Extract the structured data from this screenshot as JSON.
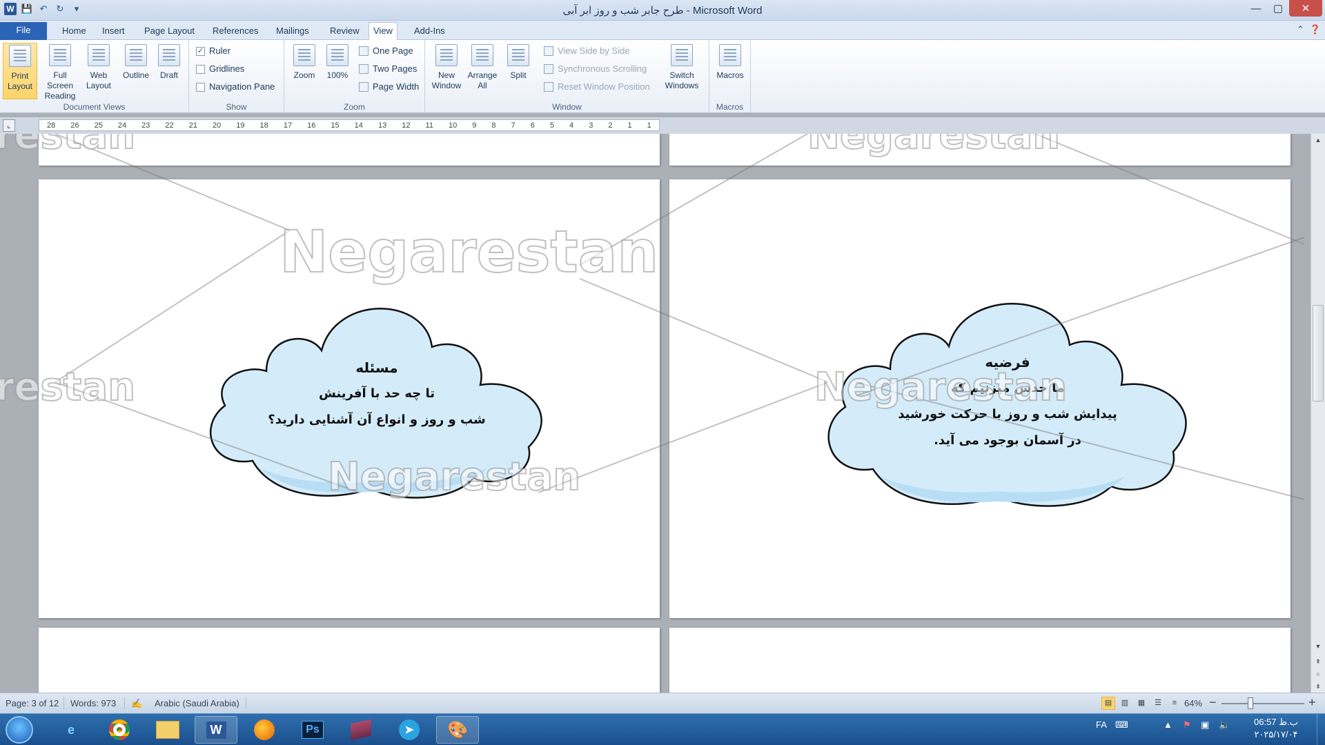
{
  "window": {
    "title": "طرح جابر شب و روز ابر آبی - Microsoft Word",
    "min": "—",
    "max": "▢",
    "close": "✕"
  },
  "qat": {
    "word": "W",
    "save": "💾",
    "undo": "↶",
    "redo": "↻",
    "custom": "▾"
  },
  "tabs": [
    {
      "label": "File"
    },
    {
      "label": "Home"
    },
    {
      "label": "Insert"
    },
    {
      "label": "Page Layout"
    },
    {
      "label": "References"
    },
    {
      "label": "Mailings"
    },
    {
      "label": "Review"
    },
    {
      "label": "View"
    },
    {
      "label": "Add-Ins"
    }
  ],
  "ribbon": {
    "document_views": {
      "label": "Document Views",
      "buttons": [
        "Print Layout",
        "Full Screen Reading",
        "Web Layout",
        "Outline",
        "Draft"
      ]
    },
    "show": {
      "label": "Show",
      "items": [
        {
          "label": "Ruler",
          "checked": "✓"
        },
        {
          "label": "Gridlines",
          "checked": ""
        },
        {
          "label": "Navigation Pane",
          "checked": ""
        }
      ]
    },
    "zoom": {
      "label": "Zoom",
      "zoom": "Zoom",
      "hundred": "100%",
      "one_page": "One Page",
      "two_pages": "Two Pages",
      "page_width": "Page Width"
    },
    "window": {
      "label": "Window",
      "new_window": "New Window",
      "arrange_all": "Arrange All",
      "split": "Split",
      "side_by_side": "View Side by Side",
      "sync_scroll": "Synchronous Scrolling",
      "reset_pos": "Reset Window Position",
      "switch_windows": "Switch Windows"
    },
    "macros": {
      "label": "Macros",
      "button": "Macros"
    }
  },
  "ruler": {
    "ticks": [
      "28",
      "26",
      "25",
      "24",
      "23",
      "22",
      "21",
      "20",
      "19",
      "18",
      "17",
      "16",
      "15",
      "14",
      "13",
      "12",
      "11",
      "10",
      "9",
      "8",
      "7",
      "6",
      "5",
      "4",
      "3",
      "2",
      "1",
      "1"
    ]
  },
  "doc": {
    "left_cloud": {
      "heading": "مسئله",
      "line1": "تا چه حد با آفرینش",
      "line2": "شب و روز و انواع آن آشنایی دارید؟"
    },
    "right_cloud": {
      "heading": "فرضیه",
      "line1": "ما حدس میزنیم که",
      "line2": "پیدایش شب و روز با حرکت خورشید",
      "line3": "در آسمان بوجود می آید."
    },
    "watermark": "Negarestan",
    "colors": {
      "cloud_fill": "#d4ecf9",
      "cloud_shade": "#b8def5"
    }
  },
  "status": {
    "page": "Page: 3 of 12",
    "words": "Words: 973",
    "language": "Arabic (Saudi Arabia)",
    "zoom": "64%",
    "minus": "−",
    "plus": "+"
  },
  "taskbar": {
    "lang": "FA",
    "time": "06:57 ب.ظ",
    "date": "۲۰۲۵/۱۷/۰۴"
  }
}
